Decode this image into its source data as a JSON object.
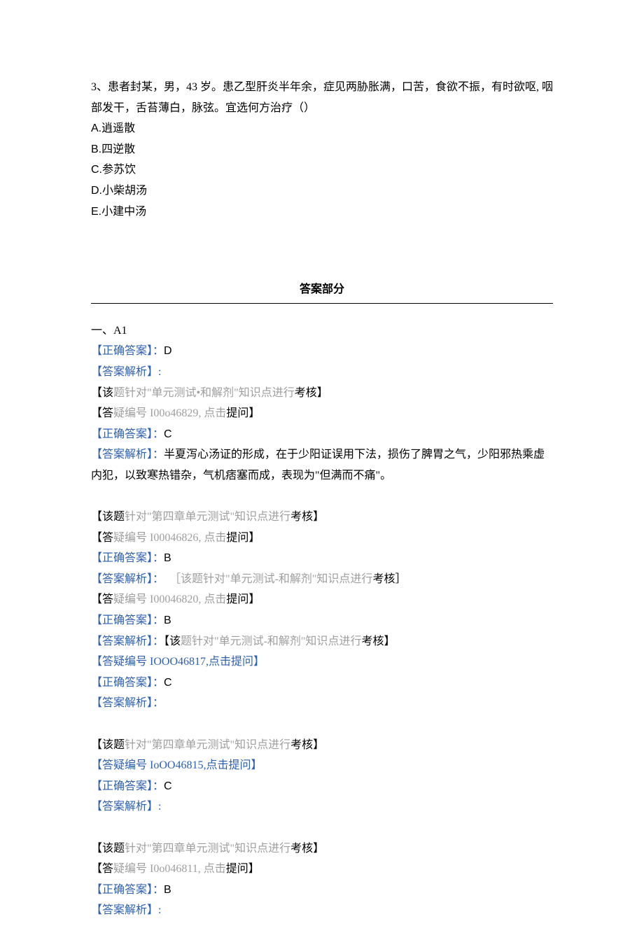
{
  "question": {
    "stem_line1": "3、患者封某，男，43 岁。患乙型肝炎半年余，症见两胁胀满，口苦，食欲不振，有时欲呕, 咽",
    "stem_line2": "部发干，舌苔薄白，脉弦。宜选何方治疗（）",
    "options": [
      "A.逍遥散",
      "B.四逆散",
      "C.参苏饮",
      "D.小柴胡汤",
      "E.小建中汤"
    ]
  },
  "answer_section_title": "答案部分",
  "section_heading": "一、A1",
  "answers": [
    {
      "correct_label": "【正确答案】：",
      "correct_value": "D",
      "analysis_label": "【答案解析】:",
      "analysis_value_lines": [],
      "ref_prefix": "【该",
      "ref_mid1": "题针对\"单元测试•和解剂\"",
      "ref_mid2": "知识点进行",
      "ref_suffix": "考核】",
      "query_prefix": "【答",
      "query_mid": "疑编号 I00o46829, 点击",
      "query_suffix": "提问】"
    },
    {
      "correct_label": "【正确答案】：",
      "correct_value": "C",
      "analysis_label": "【答案解析】：",
      "analysis_tail": "半夏泻心汤证的形成，在于少阳证误用下法，损伤了脾胃之气，少阳邪热乘虚",
      "analysis_line2": "内犯，以致寒热错杂，气机痞塞而成，表现为\"但满而不痛\"。",
      "ref_prefix": "【该题",
      "ref_mid1": "针对\"第四章单元测试\"",
      "ref_mid2": "知识点进行",
      "ref_suffix": "考核】",
      "query_prefix": "【答",
      "query_mid": "疑编号 I00046826, 点击",
      "query_suffix": "提问】"
    },
    {
      "correct_label": "【正确答案】：",
      "correct_value": "B",
      "analysis_label": "【答案解析】：",
      "analysis_tail_gray_open": "［该",
      "analysis_tail_gray_mid": "题针对\"单元测试-和解剂\"知识点进行",
      "analysis_tail_black_end": "考核］",
      "query_prefix": "【答",
      "query_mid": "疑编号 I00046820, 点击",
      "query_suffix": "提问】"
    },
    {
      "correct_label": "【正确答案】：",
      "correct_value": "B",
      "analysis_label": "【答案解析】：",
      "analysis_inline_prefix": "【该",
      "analysis_inline_mid": "题针对\"单元测试-和解剂\"知识",
      "analysis_inline_mid2": "点进行",
      "analysis_inline_suffix": "考核】",
      "query_full_blue": "【答疑编号 IOOO46817,点击提问】"
    },
    {
      "correct_label": "【正确答案】：",
      "correct_value": "C",
      "analysis_label": "【答案解析】：",
      "analysis_value_lines": [],
      "ref_prefix": "【该题",
      "ref_mid1": "针对\"第四章单元测试\"",
      "ref_mid2": "知识点进行",
      "ref_suffix": "考核】",
      "query_full_blue": "【答疑编号 IoOO46815,点击提问】"
    },
    {
      "correct_label": "【正确答案】：",
      "correct_value": "C",
      "analysis_label": "【答案解析】:",
      "analysis_value_lines": [],
      "ref_prefix": "【该题",
      "ref_mid1": "针对\"第四章单元测试\"",
      "ref_mid2": "知识点进行",
      "ref_suffix": "考核】",
      "query_prefix": "【答",
      "query_mid": "疑编号 I0o046811, 点击",
      "query_suffix": "提问】"
    },
    {
      "correct_label": "【正确答案】：",
      "correct_value": "B",
      "analysis_label": "【答案解析】:",
      "analysis_value_lines": []
    }
  ]
}
